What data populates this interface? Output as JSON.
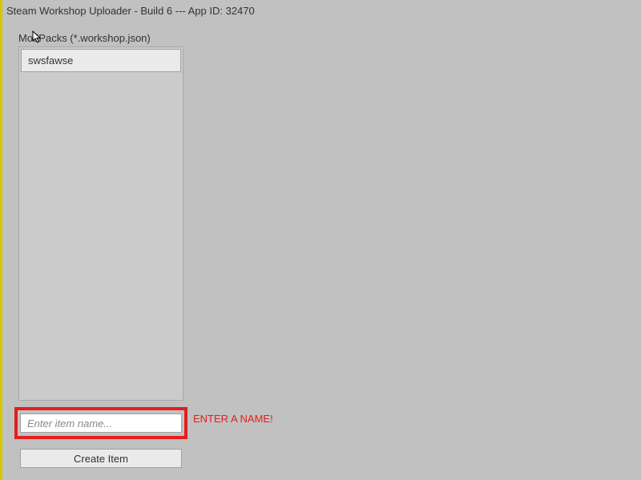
{
  "window": {
    "title": "Steam Workshop Uploader - Build 6 --- App ID: 32470"
  },
  "modpacks": {
    "label": "ModPacks (*.workshop.json)",
    "items": [
      {
        "name": "swsfawse"
      }
    ]
  },
  "item_name_input": {
    "value": "",
    "placeholder": "Enter item name..."
  },
  "error_message": "ENTER A NAME!",
  "create_button": {
    "label": "Create Item"
  }
}
